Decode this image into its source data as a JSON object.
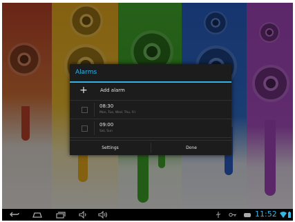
{
  "dialog": {
    "title": "Alarms",
    "add_alarm_label": "Add alarm",
    "alarms": [
      {
        "time": "08:30",
        "days": "Mon, Tue, Wed, Thu, Fri",
        "enabled": false
      },
      {
        "time": "09:00",
        "days": "Sat, Sun",
        "enabled": false
      }
    ],
    "buttons": {
      "settings": "Settings",
      "done": "Done"
    }
  },
  "status_bar": {
    "clock": "11:52",
    "accent_color": "#33b5e5",
    "nav_icons": [
      "back-icon",
      "home-icon",
      "recent-apps-icon",
      "volume-down-icon",
      "volume-up-icon"
    ],
    "system_icons": [
      "usb-icon",
      "key-icon",
      "gamepad-icon",
      "wifi-icon",
      "battery-icon"
    ]
  }
}
